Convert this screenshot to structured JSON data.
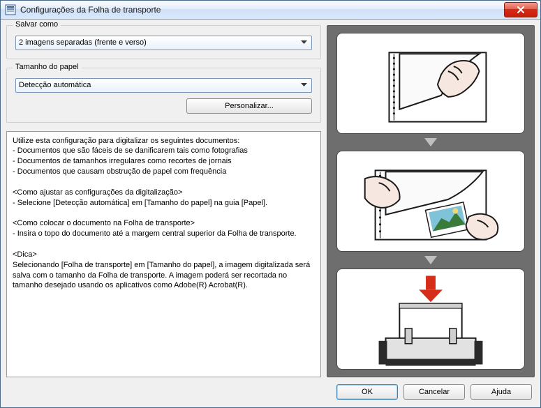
{
  "window": {
    "title": "Configurações da Folha de transporte"
  },
  "save_as": {
    "legend": "Salvar como",
    "selected": "2 imagens separadas (frente e verso)"
  },
  "paper_size": {
    "legend": "Tamanho do papel",
    "selected": "Detecção automática",
    "customize_label": "Personalizar..."
  },
  "help_text": "Utilize esta configuração para digitalizar os seguintes documentos:\n- Documentos que são fáceis de se danificarem tais como fotografias\n- Documentos de tamanhos irregulares como recortes de jornais\n- Documentos que causam obstrução de papel com frequência\n\n<Como ajustar as configurações da digitalização>\n- Selecione [Detecção automática] em [Tamanho do papel] na guia [Papel].\n\n<Como colocar o documento na Folha de transporte>\n- Insira o topo do documento até a margem central superior da Folha de transporte.\n\n<Dica>\nSelecionando [Folha de transporte] em [Tamanho do papel], a imagem digitalizada será salva com o tamanho da Folha de transporte. A imagem poderá ser recortada no tamanho desejado usando os aplicativos como Adobe(R) Acrobat(R).",
  "buttons": {
    "ok": "OK",
    "cancel": "Cancelar",
    "help": "Ajuda"
  }
}
